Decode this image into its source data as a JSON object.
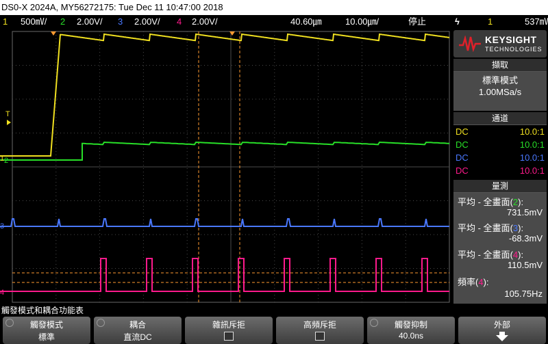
{
  "title": "DS0-X 2024A, MY56272175: Tue Dec 11 10:47:00 2018",
  "status": {
    "ch1_num": "1",
    "ch1_scale": "500㎷/",
    "ch2_num": "2",
    "ch2_scale": "2.00V/",
    "ch3_num": "3",
    "ch3_scale": "2.00V/",
    "ch4_num": "4",
    "ch4_scale": "2.00V/",
    "delay": "40.60㎛",
    "timebase": "10.00㎛/",
    "run_state": "停止",
    "trig_icon": "ϟ",
    "trig_ch": "1",
    "trig_level": "537㎷"
  },
  "colors": {
    "ch1": "#f0e020",
    "ch2": "#28e028",
    "ch3": "#4a78ff",
    "ch4": "#ff1a8c",
    "marker": "#ff9a30"
  },
  "right_panel": {
    "brand": "KEYSIGHT",
    "brand_sub": "TECHNOLOGIES",
    "acq_header": "擷取",
    "acq_mode": "標準模式",
    "acq_rate": "1.00MSa/s",
    "chan_header": "通道",
    "channels": [
      {
        "coupling": "DC",
        "probe": "10.0:1"
      },
      {
        "coupling": "DC",
        "probe": "10.0:1"
      },
      {
        "coupling": "DC",
        "probe": "10.0:1"
      },
      {
        "coupling": "DC",
        "probe": "10.0:1"
      }
    ],
    "meas_header": "量測",
    "measurements": [
      {
        "label": "平均 - 全畫面",
        "src": "2",
        "value": "731.5mV"
      },
      {
        "label": "平均 - 全畫面",
        "src": "3",
        "value": "-68.3mV"
      },
      {
        "label": "平均 - 全畫面",
        "src": "4",
        "value": "110.5mV"
      },
      {
        "label": "頻率",
        "src": "4",
        "value": "105.75Hz"
      }
    ]
  },
  "screen": {
    "trig_marker": "T",
    "ground_labels": [
      "1",
      "2",
      "3",
      "4"
    ]
  },
  "message": "觸發模式和耦合功能表",
  "softkeys": [
    {
      "label": "觸發模式",
      "value": "標準"
    },
    {
      "label": "耦合",
      "value": "直流DC"
    },
    {
      "label": "雜訊斥拒",
      "value": ""
    },
    {
      "label": "高頻斥拒",
      "value": ""
    },
    {
      "label": "觸發抑制",
      "value": "40.0ns"
    },
    {
      "label": "外部",
      "value": ""
    }
  ]
}
